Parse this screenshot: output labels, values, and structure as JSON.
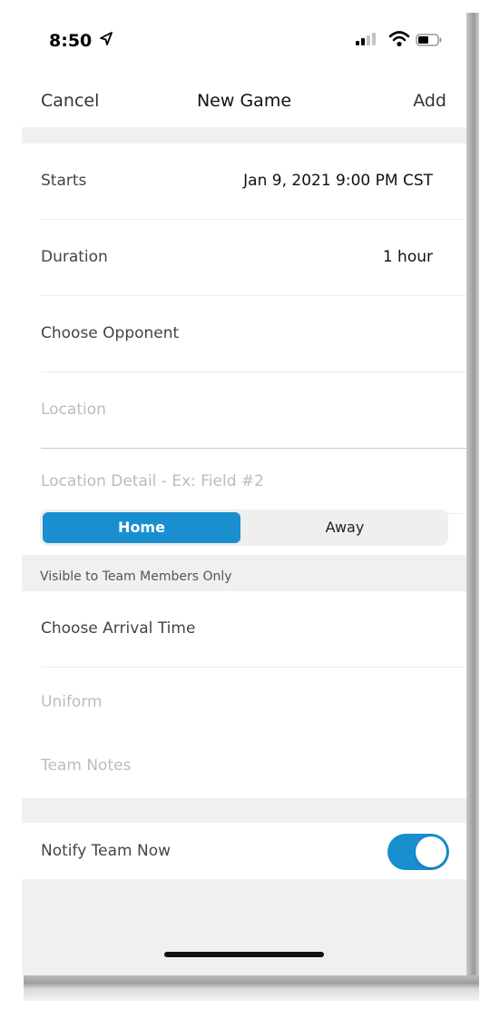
{
  "status_bar": {
    "time": "8:50"
  },
  "nav": {
    "cancel": "Cancel",
    "title": "New Game",
    "add": "Add"
  },
  "form": {
    "starts_label": "Starts",
    "starts_value": "Jan 9, 2021 9:00 PM CST",
    "duration_label": "Duration",
    "duration_value": "1 hour",
    "opponent_label": "Choose Opponent",
    "location_placeholder": "Location",
    "location_detail_placeholder": "Location Detail - Ex: Field #2",
    "home_away": {
      "options": [
        "Home",
        "Away"
      ],
      "selected": "Home"
    },
    "visibility_note": "Visible to Team Members Only",
    "arrival_label": "Choose Arrival Time",
    "uniform_placeholder": "Uniform",
    "team_notes_placeholder": "Team Notes",
    "notify_label": "Notify Team Now",
    "notify_enabled": true
  },
  "colors": {
    "accent": "#1a8fd0",
    "background": "#f0f0f0",
    "placeholder_text": "#bcbcbc"
  }
}
